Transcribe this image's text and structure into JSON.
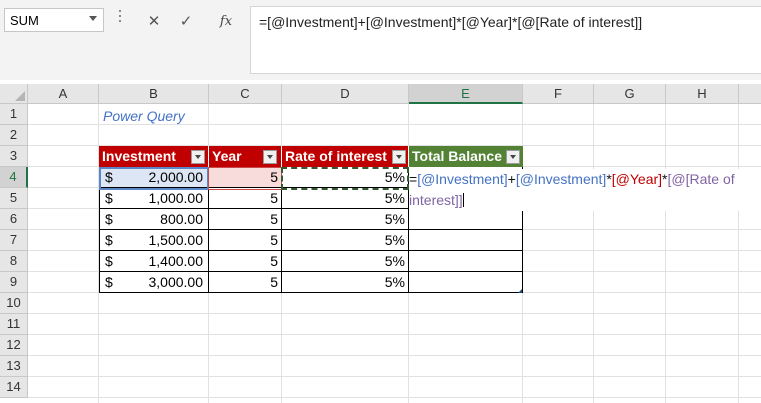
{
  "formula_bar": {
    "name_box": "SUM",
    "cancel_glyph": "✕",
    "enter_glyph": "✓",
    "fx_label": "fx",
    "formula": "=[@Investment]+[@Investment]*[@Year]*[@[Rate of interest]]"
  },
  "columns": [
    "A",
    "B",
    "C",
    "D",
    "E",
    "F",
    "G",
    "H"
  ],
  "rows": [
    "1",
    "2",
    "3",
    "4",
    "5",
    "6",
    "7",
    "8",
    "9",
    "10",
    "11",
    "12",
    "13",
    "14"
  ],
  "selected_column": "E",
  "selected_row": "4",
  "sheet": {
    "label_b1": "Power Query",
    "table": {
      "headers": [
        "Investment",
        "Year",
        "Rate of interest",
        "Total Balance"
      ],
      "rows": [
        {
          "currency": "$",
          "investment": "2,000.00",
          "year": "5",
          "rate": "5%"
        },
        {
          "currency": "$",
          "investment": "1,000.00",
          "year": "5",
          "rate": "5%"
        },
        {
          "currency": "$",
          "investment": "800.00",
          "year": "5",
          "rate": "5%"
        },
        {
          "currency": "$",
          "investment": "1,500.00",
          "year": "5",
          "rate": "5%"
        },
        {
          "currency": "$",
          "investment": "1,400.00",
          "year": "5",
          "rate": "5%"
        },
        {
          "currency": "$",
          "investment": "3,000.00",
          "year": "5",
          "rate": "5%"
        }
      ]
    },
    "editing_cell": {
      "t1": "=",
      "t2": "[@Investment]",
      "t3": "+",
      "t4": "[@Investment]",
      "t5": "*",
      "t6": "[@Year]",
      "t7": "*",
      "t8": "[@[Rate of",
      "t9": "interest]]"
    }
  },
  "colors": {
    "header_red": "#c00000",
    "header_green": "#548235",
    "ref_blue": "#4472c4",
    "ref_purple": "#8064a2",
    "excel_green": "#217346"
  },
  "icons": [
    "cancel-icon",
    "enter-icon",
    "fx-icon",
    "filter-dropdown-icon"
  ]
}
